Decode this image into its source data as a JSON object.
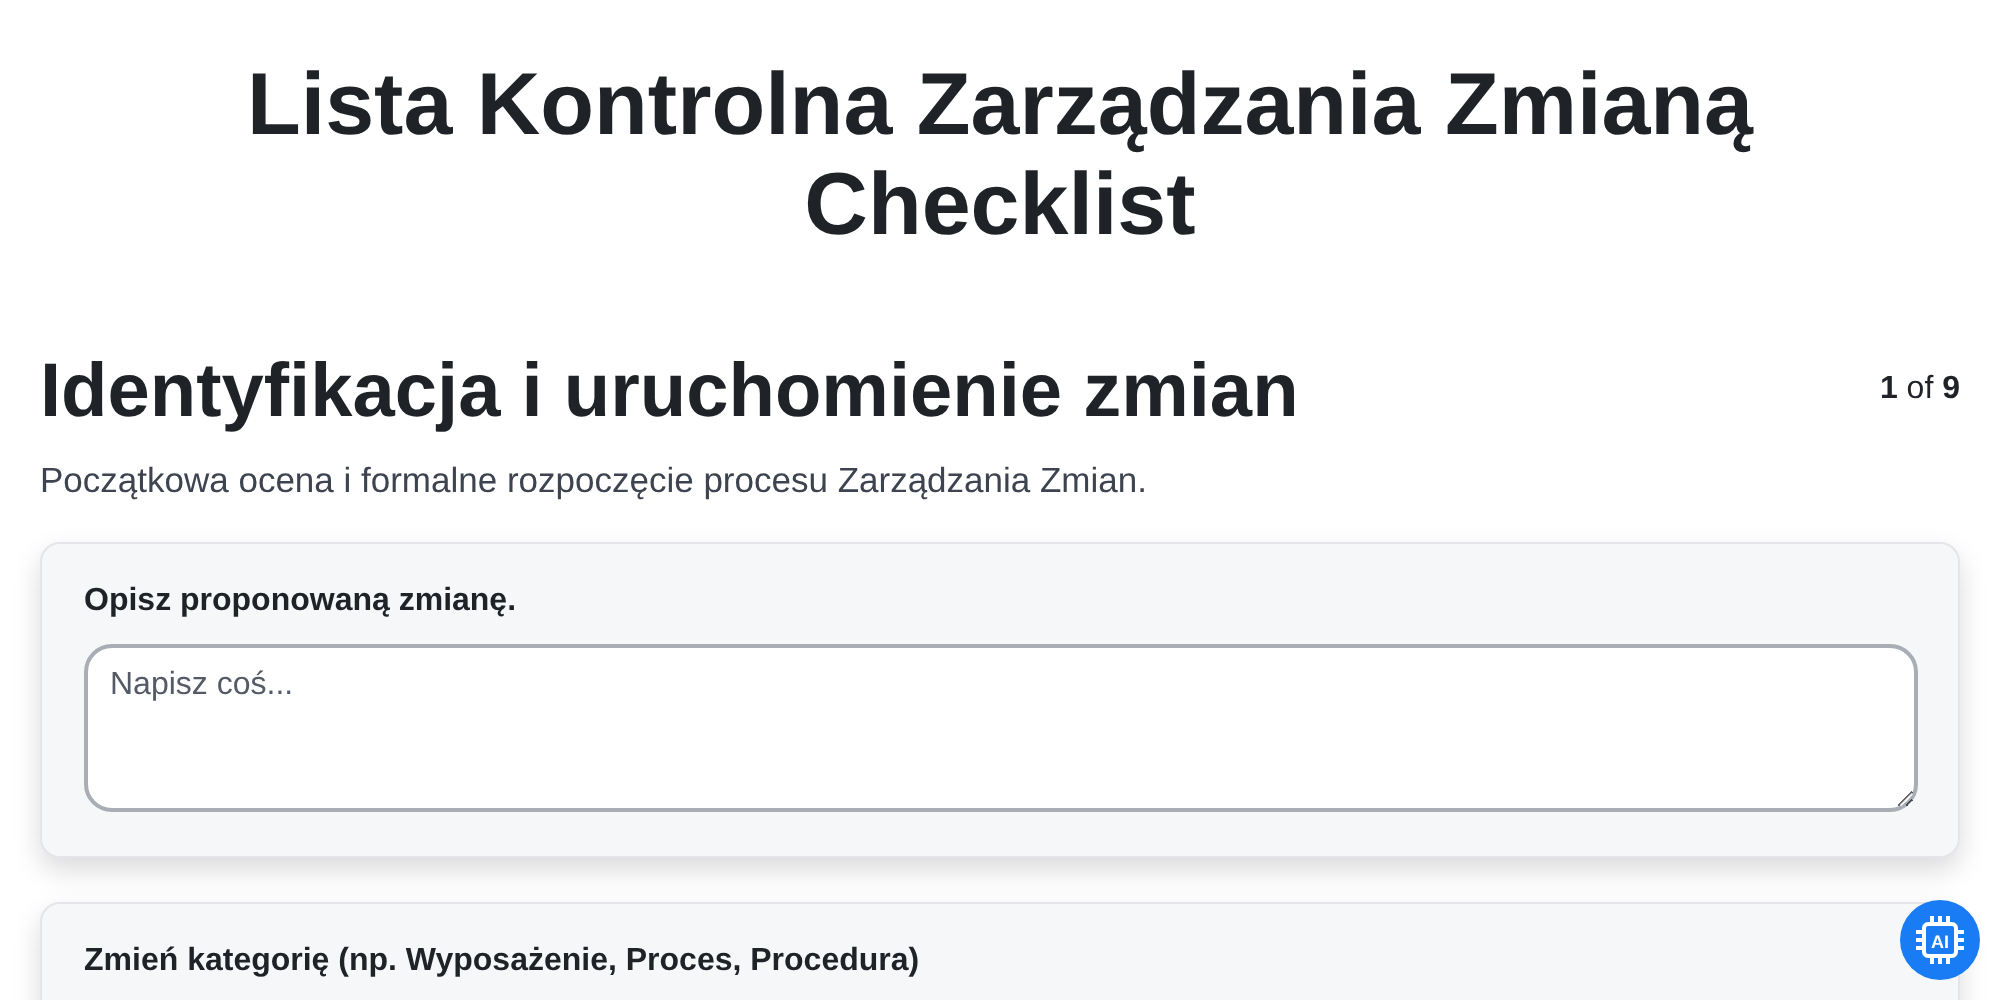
{
  "title": "Lista Kontrolna Zarządzania Zmianą Checklist",
  "section": {
    "heading": "Identyfikacja i uruchomienie zmian",
    "description": "Początkowa ocena i formalne rozpoczęcie procesu Zarządzania Zmian.",
    "page_current": "1",
    "page_of": "of",
    "page_total": "9"
  },
  "questions": [
    {
      "kind": "textarea",
      "label": "Opisz proponowaną zmianę.",
      "placeholder": "Napisz coś..."
    },
    {
      "kind": "label_only",
      "label": "Zmień kategorię (np. Wyposażenie, Proces, Procedura)"
    }
  ],
  "ai_button": {
    "label": "AI"
  }
}
